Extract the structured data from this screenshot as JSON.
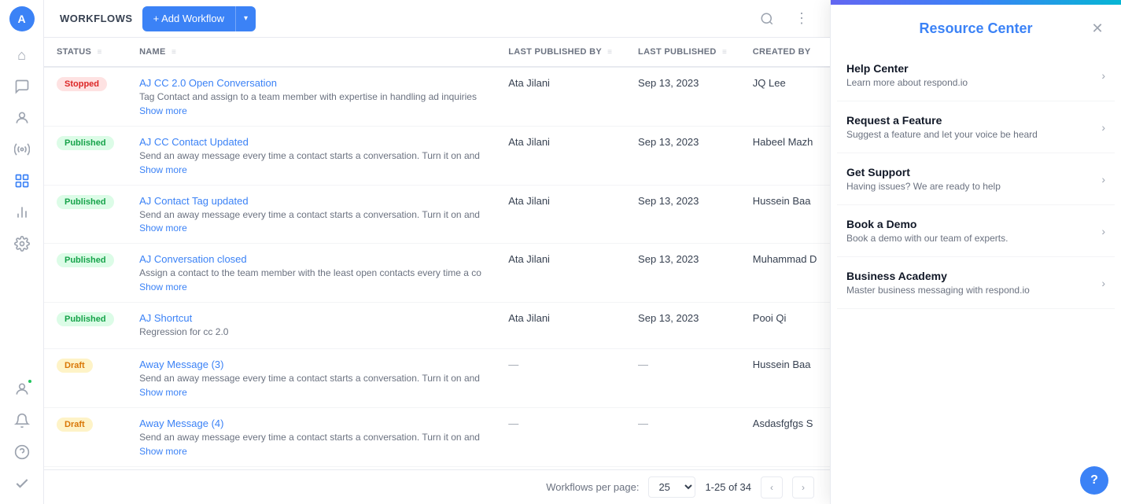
{
  "sidebar": {
    "avatar": "A",
    "icons": [
      {
        "name": "home-icon",
        "symbol": "⌂",
        "active": false
      },
      {
        "name": "chat-icon",
        "symbol": "💬",
        "active": false
      },
      {
        "name": "contacts-icon",
        "symbol": "👤",
        "active": false
      },
      {
        "name": "broadcast-icon",
        "symbol": "📡",
        "active": false
      },
      {
        "name": "workflows-icon",
        "symbol": "⬡",
        "active": true
      },
      {
        "name": "reports-icon",
        "symbol": "📊",
        "active": false
      },
      {
        "name": "settings-icon",
        "symbol": "⚙",
        "active": false
      }
    ],
    "bottom_icons": [
      {
        "name": "user-icon",
        "symbol": "👤"
      },
      {
        "name": "notifications-icon",
        "symbol": "🔔"
      },
      {
        "name": "help-icon",
        "symbol": "?"
      },
      {
        "name": "check-icon",
        "symbol": "✓"
      }
    ]
  },
  "header": {
    "title": "WORKFLOWS",
    "add_button_label": "+ Add Workflow",
    "search_icon": "🔍",
    "more_icon": "⋮"
  },
  "table": {
    "columns": [
      "STATUS",
      "NAME",
      "LAST PUBLISHED BY",
      "LAST PUBLISHED",
      "CREATED BY"
    ],
    "rows": [
      {
        "status": "Stopped",
        "status_type": "stopped",
        "name": "AJ CC 2.0 Open Conversation",
        "desc": "Tag Contact and assign to a team member with expertise in handling ad inquiries",
        "show_more": true,
        "last_published_by": "Ata Jilani",
        "last_published": "Sep 13, 2023",
        "created_by": "JQ Lee"
      },
      {
        "status": "Published",
        "status_type": "published",
        "name": "AJ CC Contact Updated",
        "desc": "Send an away message every time a contact starts a conversation. Turn it on and",
        "show_more": true,
        "last_published_by": "Ata Jilani",
        "last_published": "Sep 13, 2023",
        "created_by": "Habeel Mazh"
      },
      {
        "status": "Published",
        "status_type": "published",
        "name": "AJ Contact Tag updated",
        "desc": "Send an away message every time a contact starts a conversation. Turn it on and",
        "show_more": true,
        "last_published_by": "Ata Jilani",
        "last_published": "Sep 13, 2023",
        "created_by": "Hussein Baa"
      },
      {
        "status": "Published",
        "status_type": "published",
        "name": "AJ Conversation closed",
        "desc": "Assign a contact to the team member with the least open contacts every time a co",
        "show_more": true,
        "last_published_by": "Ata Jilani",
        "last_published": "Sep 13, 2023",
        "created_by": "Muhammad D"
      },
      {
        "status": "Published",
        "status_type": "published",
        "name": "AJ Shortcut",
        "desc": "Regression for cc 2.0",
        "show_more": false,
        "last_published_by": "Ata Jilani",
        "last_published": "Sep 13, 2023",
        "created_by": "Pooi Qi"
      },
      {
        "status": "Draft",
        "status_type": "draft",
        "name": "Away Message (3)",
        "desc": "Send an away message every time a contact starts a conversation. Turn it on and",
        "show_more": true,
        "last_published_by": "—",
        "last_published": "—",
        "created_by": "Hussein Baa"
      },
      {
        "status": "Draft",
        "status_type": "draft",
        "name": "Away Message (4)",
        "desc": "Send an away message every time a contact starts a conversation. Turn it on and",
        "show_more": true,
        "last_published_by": "—",
        "last_published": "—",
        "created_by": "Asdasfgfgs S"
      }
    ]
  },
  "footer": {
    "label": "Workflows per page:",
    "per_page": "25",
    "page_range": "1-25 of 34"
  },
  "resource_center": {
    "title": "Resource Center",
    "items": [
      {
        "title": "Help Center",
        "desc": "Learn more about respond.io"
      },
      {
        "title": "Request a Feature",
        "desc": "Suggest a feature and let your voice be heard"
      },
      {
        "title": "Get Support",
        "desc": "Having issues? We are ready to help"
      },
      {
        "title": "Book a Demo",
        "desc": "Book a demo with our team of experts."
      },
      {
        "title": "Business Academy",
        "desc": "Master business messaging with respond.io"
      }
    ]
  }
}
